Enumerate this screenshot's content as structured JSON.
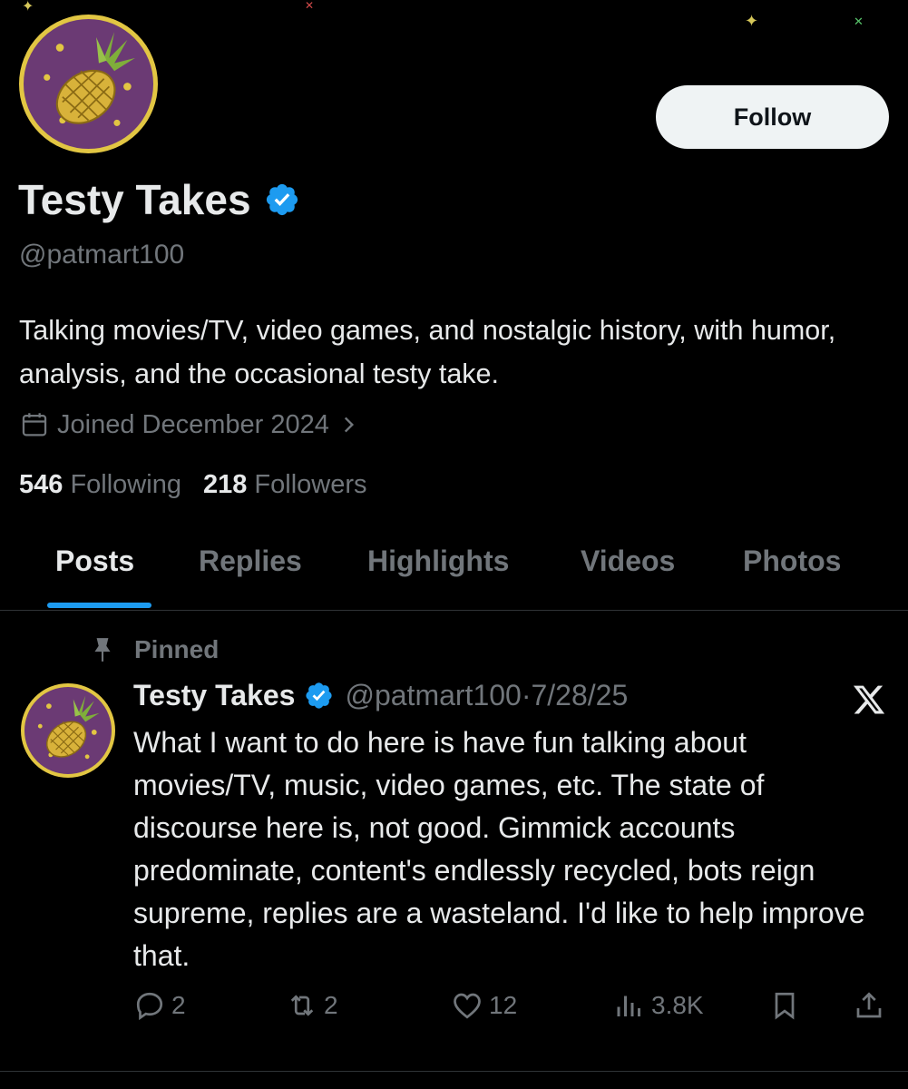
{
  "profile": {
    "display_name": "Testy Takes",
    "handle": "@patmart100",
    "bio": "Talking movies/TV, video games, and nostalgic history, with humor, analysis, and the occasional testy take.",
    "joined": "Joined December 2024",
    "following_count": "546",
    "following_label": "Following",
    "followers_count": "218",
    "followers_label": "Followers",
    "follow_button": "Follow",
    "avatar_icon": "pineapple-icon"
  },
  "tabs": [
    {
      "label": "Posts",
      "active": true
    },
    {
      "label": "Replies"
    },
    {
      "label": "Highlights"
    },
    {
      "label": "Videos"
    },
    {
      "label": "Photos"
    }
  ],
  "post": {
    "pinned_label": "Pinned",
    "author_name": "Testy Takes",
    "author_handle": "@patmart100",
    "separator": "·",
    "date": "7/28/25",
    "text": "What I want to do here is have fun talking about movies/TV, music, video games, etc. The state of discourse here is, not good. Gimmick accounts predominate, content's endlessly recycled, bots reign supreme, replies are a wasteland. I'd like to help improve that.",
    "replies": "2",
    "reposts": "2",
    "likes": "12",
    "views": "3.8K"
  },
  "colors": {
    "accent": "#1d9bf0",
    "verified": "#1d9bf0",
    "avatar_bg": "#6b3a74",
    "avatar_ring": "#e2c643",
    "muted_text": "#71767b"
  }
}
